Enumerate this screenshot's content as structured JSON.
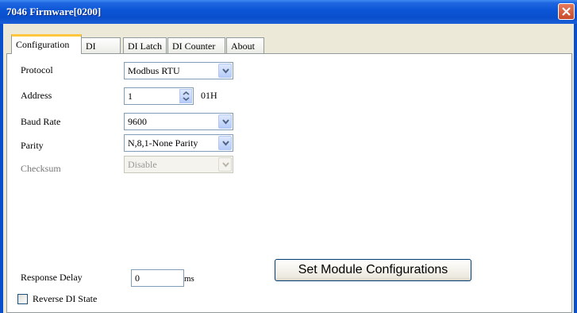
{
  "window": {
    "title": "7046 Firmware[0200]"
  },
  "tabs": [
    {
      "label": "Configuration"
    },
    {
      "label": "DI"
    },
    {
      "label": "DI Latch"
    },
    {
      "label": "DI Counter"
    },
    {
      "label": "About"
    }
  ],
  "config": {
    "protocol": {
      "label": "Protocol",
      "value": "Modbus RTU"
    },
    "address": {
      "label": "Address",
      "value": "1",
      "hex": "01H"
    },
    "baud_rate": {
      "label": "Baud Rate",
      "value": "9600"
    },
    "parity": {
      "label": "Parity",
      "value": "N,8,1-None Parity"
    },
    "checksum": {
      "label": "Checksum",
      "value": "Disable"
    },
    "response_delay": {
      "label": "Response Delay",
      "value": "0",
      "unit": "ms"
    },
    "reverse_di": {
      "label": "Reverse DI State",
      "checked": false
    },
    "set_button": "Set Module Configurations"
  }
}
